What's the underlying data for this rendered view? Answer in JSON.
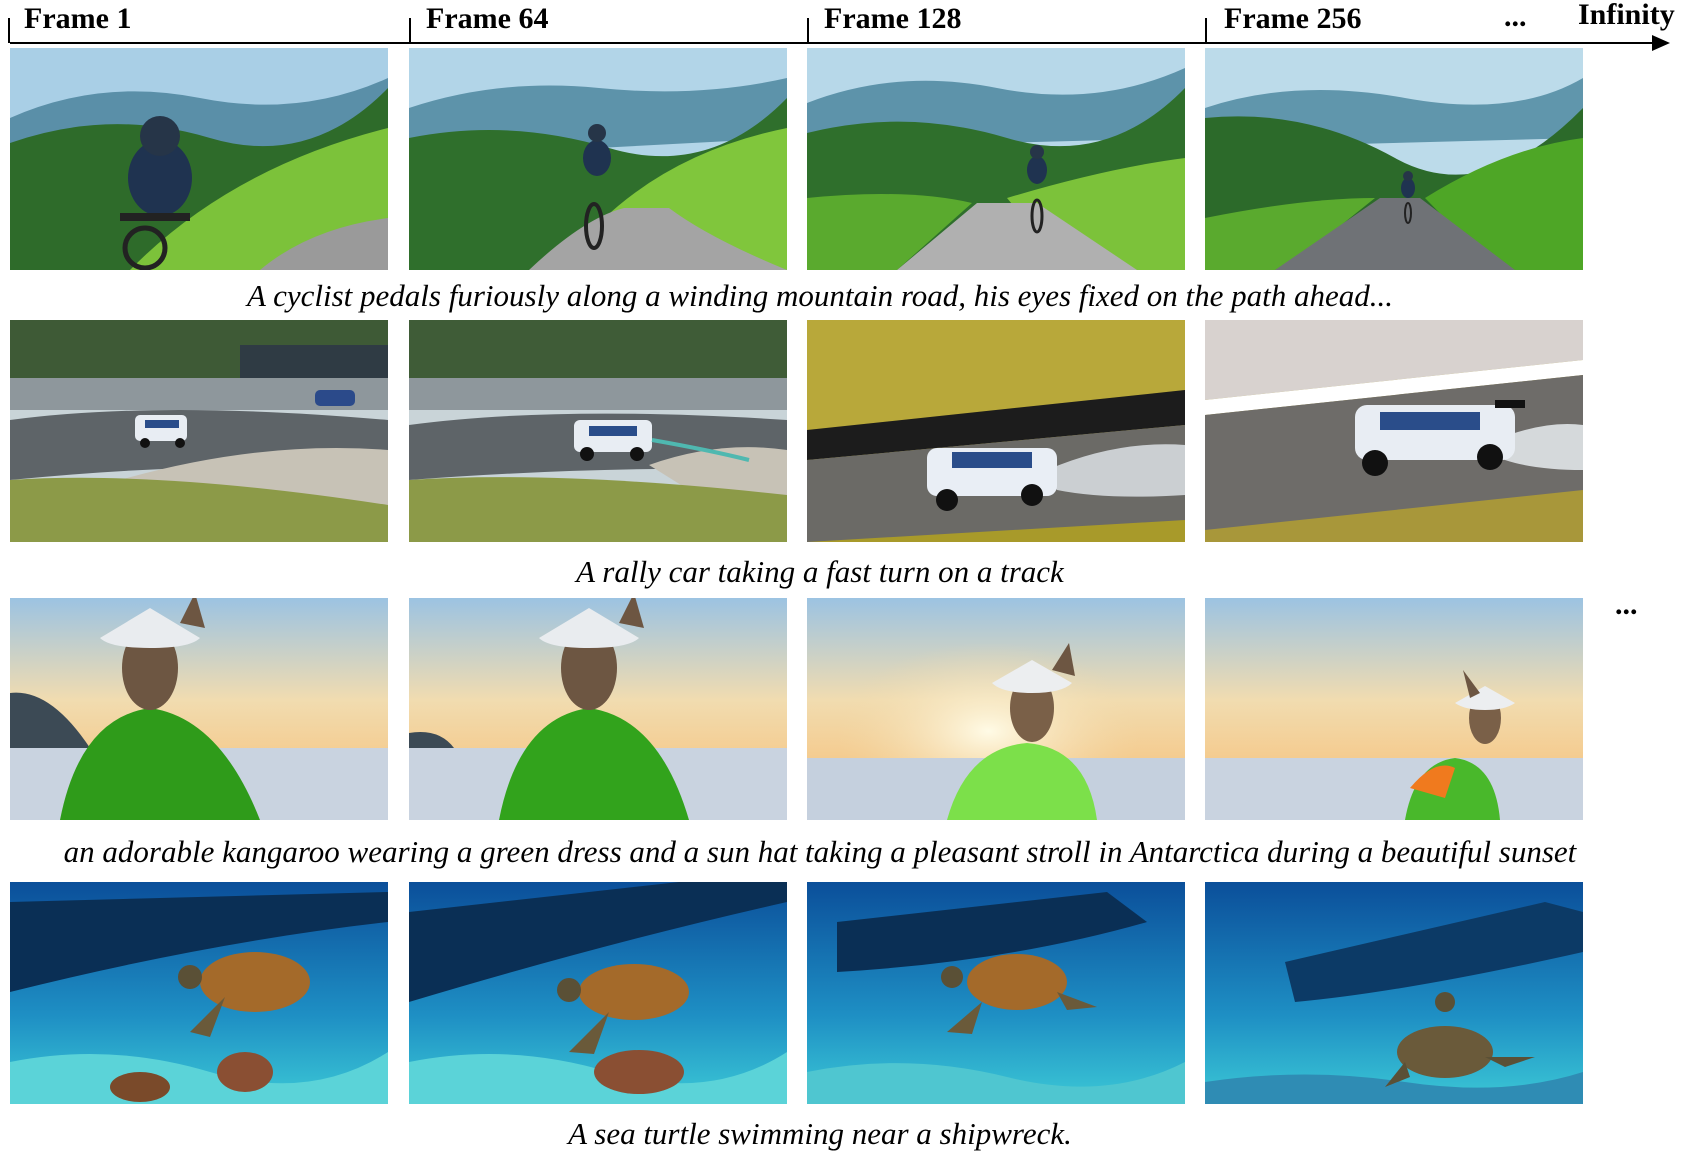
{
  "timeline": {
    "frames": [
      "Frame 1",
      "Frame 64",
      "Frame 128",
      "Frame 256"
    ],
    "ellipsis": "...",
    "end_label": "Infinity"
  },
  "rows": [
    {
      "caption": "A cyclist pedals furiously along a winding mountain road, his eyes fixed on the path ahead..."
    },
    {
      "caption": "A rally car taking a fast turn on a track"
    },
    {
      "caption": "an adorable kangaroo wearing a green dress and a sun hat taking a pleasant stroll in Antarctica during a beautiful sunset"
    },
    {
      "caption": "A sea turtle swimming near a shipwreck."
    }
  ],
  "side_ellipsis": "..."
}
